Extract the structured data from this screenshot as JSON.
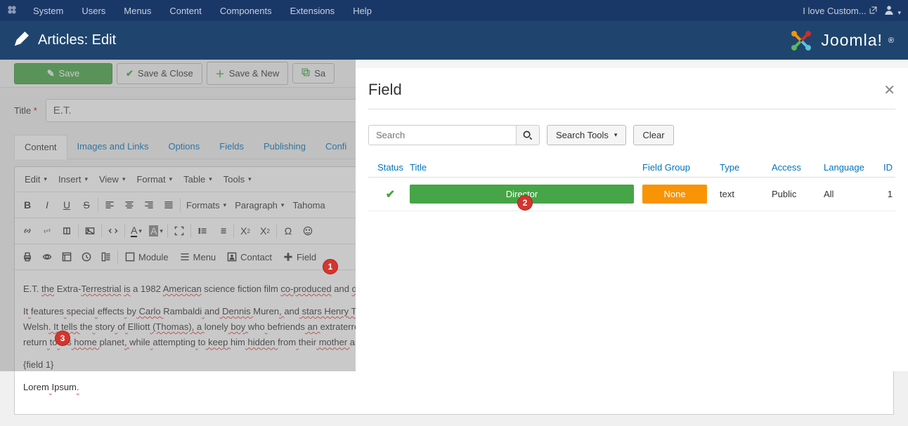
{
  "topbar": {
    "menus": [
      "System",
      "Users",
      "Menus",
      "Content",
      "Components",
      "Extensions",
      "Help"
    ],
    "siteName": "I love Custom..."
  },
  "header": {
    "title": "Articles: Edit",
    "brand": "Joomla!"
  },
  "toolbar": {
    "save": "Save",
    "saveClose": "Save & Close",
    "saveNew": "Save & New",
    "saveCopy": "Sa"
  },
  "article": {
    "titleLabel": "Title",
    "titleValue": "E.T."
  },
  "tabs": [
    "Content",
    "Images and Links",
    "Options",
    "Fields",
    "Publishing",
    "Confi"
  ],
  "editorMenus": [
    "Edit",
    "Insert",
    "View",
    "Format",
    "Table",
    "Tools"
  ],
  "editorSelects": {
    "formats": "Formats",
    "block": "Paragraph",
    "font": "Tahoma"
  },
  "editorButtons": {
    "module": "Module",
    "menu": "Menu",
    "contact": "Contact",
    "field": "Field"
  },
  "body": {
    "p1_parts": [
      "E.T. ",
      "the",
      " Extra-",
      "Terrestrial",
      " ",
      "is",
      " a 1982 ",
      "American",
      " science fiction film ",
      "co-produced",
      " and ",
      "direc"
    ],
    "p2a_parts": [
      "It",
      " ",
      "features",
      " ",
      "special",
      " ",
      "effects",
      " ",
      "by",
      " Carlo ",
      "Rambaldi",
      " ",
      "and",
      " Dennis ",
      "Muren",
      ", ",
      "and",
      " stars Henry Thom"
    ],
    "p2b_parts": [
      "Welsh",
      ". It tells ",
      "the",
      " ",
      "story",
      " ",
      "of",
      " ",
      "Elliott",
      " (Thomas), a ",
      "lonely",
      " boy ",
      "who",
      " ",
      "befriends",
      " an ",
      "extraterres"
    ],
    "p2c_parts": [
      "return",
      " ",
      "to",
      " ",
      "his",
      " home ",
      "planet",
      ", ",
      "while",
      " ",
      "attempting",
      " ",
      "to",
      " keep ",
      "him",
      " hidden ",
      "from",
      " ",
      "their",
      " mother ",
      "and"
    ],
    "p3": "{field 1}",
    "p4_parts": [
      "Lorem",
      " ",
      "Ipsum",
      "."
    ]
  },
  "badges": {
    "b1": "1",
    "b2": "2",
    "b3": "3"
  },
  "modal": {
    "title": "Field",
    "searchPh": "Search",
    "searchTools": "Search Tools",
    "clear": "Clear",
    "columns": {
      "status": "Status",
      "title": "Title",
      "group": "Field Group",
      "type": "Type",
      "access": "Access",
      "language": "Language",
      "id": "ID"
    },
    "row": {
      "title": "Director",
      "group": "None",
      "type": "text",
      "access": "Public",
      "language": "All",
      "id": "1"
    }
  },
  "chart_data": {
    "type": "table",
    "note": "not-a-chart"
  }
}
